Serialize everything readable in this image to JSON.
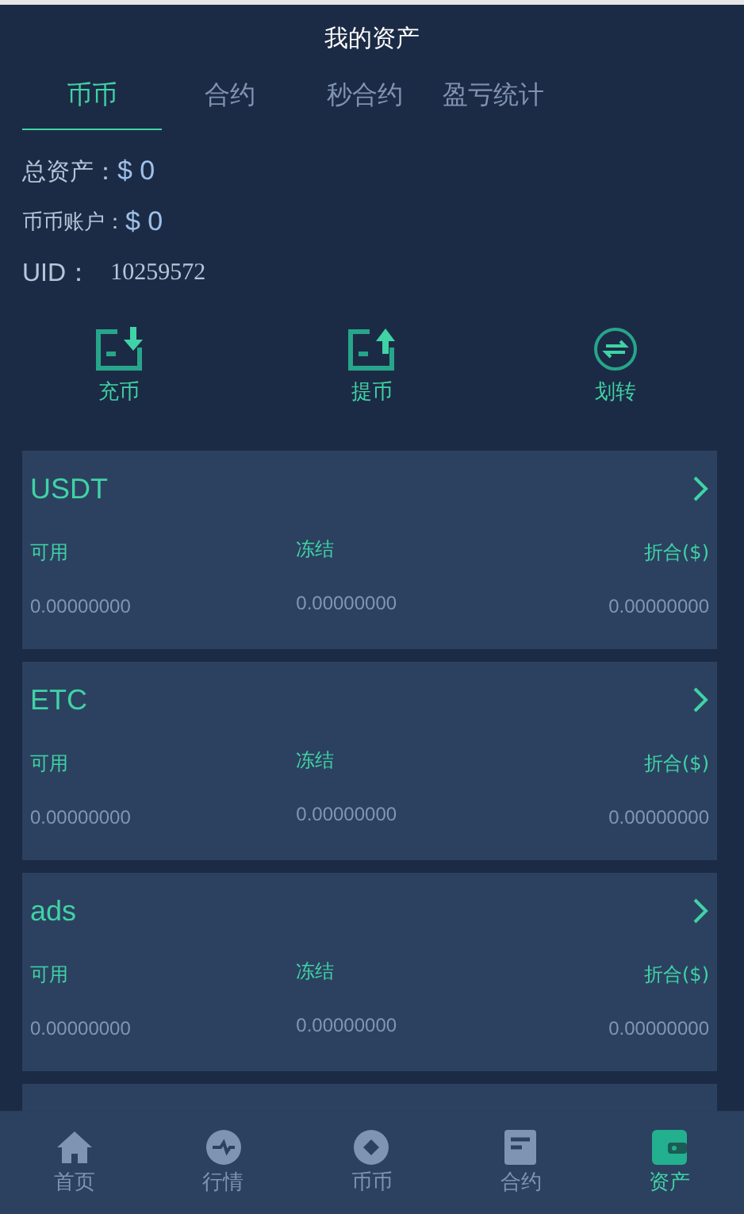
{
  "header": {
    "title": "我的资产"
  },
  "tabs": [
    {
      "label": "币币",
      "selected": true
    },
    {
      "label": "合约",
      "selected": false
    },
    {
      "label": "秒合约",
      "selected": false
    },
    {
      "label": "盈亏统计",
      "selected": false
    }
  ],
  "summary": [
    {
      "label": "总资产：",
      "value": "$ 0"
    },
    {
      "label": "币币账户：",
      "value": "$ 0"
    },
    {
      "label": "UID：",
      "value": "10259572"
    }
  ],
  "actions": [
    {
      "kind": "deposit",
      "label": "充币"
    },
    {
      "kind": "withdraw",
      "label": "提币"
    },
    {
      "kind": "transfer",
      "label": "划转"
    }
  ],
  "assets": [
    {
      "name": "USDT",
      "columns": [
        "可用",
        "冻结",
        "折合($)"
      ],
      "values": [
        "0.00000000",
        "0.00000000",
        "0.00000000"
      ]
    },
    {
      "name": "ETC",
      "columns": [
        "可用",
        "冻结",
        "折合($)"
      ],
      "values": [
        "0.00000000",
        "0.00000000",
        "0.00000000"
      ]
    },
    {
      "name": "ads",
      "columns": [
        "可用",
        "冻结",
        "折合($)"
      ],
      "values": [
        "0.00000000",
        "0.00000000",
        "0.00000000"
      ]
    }
  ],
  "nav": [
    {
      "kind": "home",
      "label": "首页",
      "selected": false
    },
    {
      "kind": "market",
      "label": "行情",
      "selected": false
    },
    {
      "kind": "coin",
      "label": "币币",
      "selected": false
    },
    {
      "kind": "contract",
      "label": "合约",
      "selected": false
    },
    {
      "kind": "assets",
      "label": "资产",
      "selected": true
    }
  ]
}
